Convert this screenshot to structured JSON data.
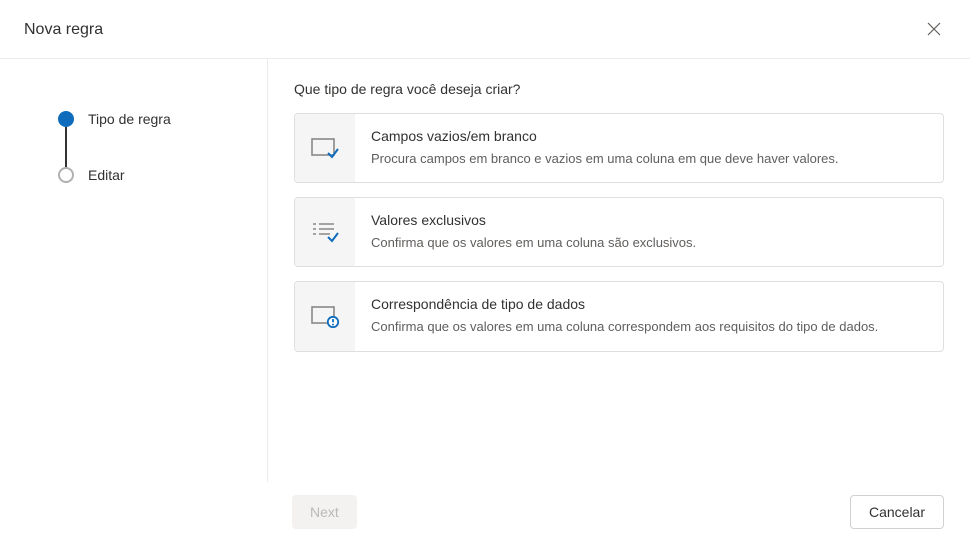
{
  "header": {
    "title": "Nova regra"
  },
  "stepper": {
    "steps": [
      {
        "label": "Tipo de regra",
        "active": true
      },
      {
        "label": "Editar",
        "active": false
      }
    ]
  },
  "content": {
    "prompt": "Que tipo de regra você deseja criar?",
    "options": [
      {
        "icon": "blank-field-icon",
        "title": "Campos vazios/em branco",
        "desc": "Procura campos em branco e vazios em uma coluna em que deve haver valores."
      },
      {
        "icon": "unique-values-icon",
        "title": "Valores exclusivos",
        "desc": "Confirma que os valores em uma coluna são exclusivos."
      },
      {
        "icon": "type-match-icon",
        "title": "Correspondência de tipo de dados",
        "desc": "Confirma que os valores em uma coluna correspondem aos requisitos do tipo de dados."
      }
    ]
  },
  "footer": {
    "next_label": "Next",
    "cancel_label": "Cancelar"
  }
}
